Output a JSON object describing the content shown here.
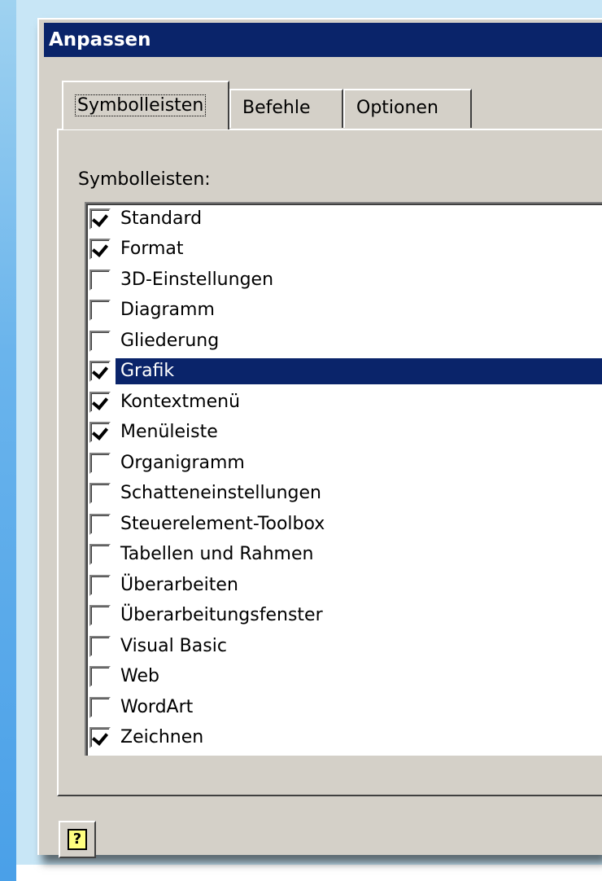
{
  "window": {
    "title": "Anpassen"
  },
  "tabs": [
    {
      "label": "Symbolleisten",
      "active": true
    },
    {
      "label": "Befehle",
      "active": false
    },
    {
      "label": "Optionen",
      "active": false
    }
  ],
  "list_label": "Symbolleisten:",
  "toolbars": [
    {
      "label": "Standard",
      "checked": true,
      "selected": false
    },
    {
      "label": "Format",
      "checked": true,
      "selected": false
    },
    {
      "label": "3D-Einstellungen",
      "checked": false,
      "selected": false
    },
    {
      "label": "Diagramm",
      "checked": false,
      "selected": false
    },
    {
      "label": "Gliederung",
      "checked": false,
      "selected": false
    },
    {
      "label": "Grafik",
      "checked": true,
      "selected": true
    },
    {
      "label": "Kontextmenü",
      "checked": true,
      "selected": false
    },
    {
      "label": "Menüleiste",
      "checked": true,
      "selected": false
    },
    {
      "label": "Organigramm",
      "checked": false,
      "selected": false
    },
    {
      "label": "Schatteneinstellungen",
      "checked": false,
      "selected": false
    },
    {
      "label": "Steuerelement-Toolbox",
      "checked": false,
      "selected": false
    },
    {
      "label": "Tabellen und Rahmen",
      "checked": false,
      "selected": false
    },
    {
      "label": "Überarbeiten",
      "checked": false,
      "selected": false
    },
    {
      "label": "Überarbeitungsfenster",
      "checked": false,
      "selected": false
    },
    {
      "label": "Visual Basic",
      "checked": false,
      "selected": false
    },
    {
      "label": "Web",
      "checked": false,
      "selected": false
    },
    {
      "label": "WordArt",
      "checked": false,
      "selected": false
    },
    {
      "label": "Zeichnen",
      "checked": true,
      "selected": false
    }
  ],
  "help_button": {
    "glyph": "?",
    "icon": "help-icon"
  },
  "colors": {
    "titlebar": "#0a246a",
    "dialog": "#d4d0c8",
    "selection": "#0a246a"
  }
}
